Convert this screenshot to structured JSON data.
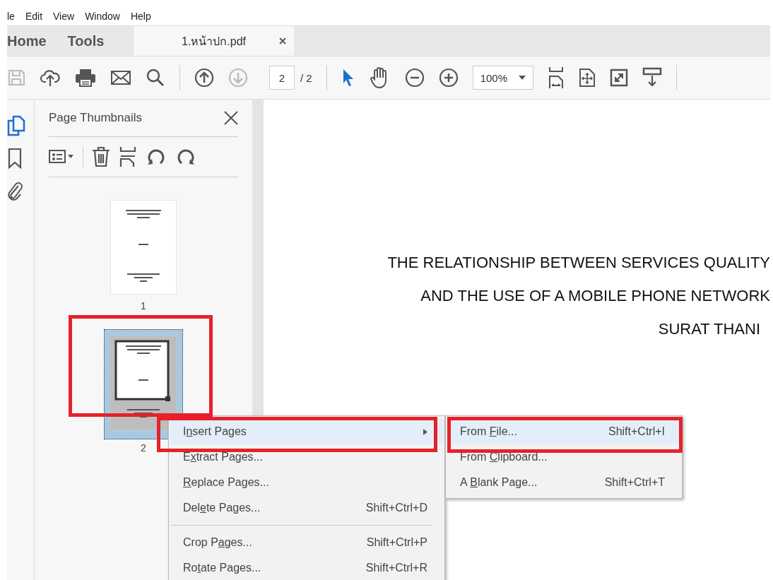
{
  "menu_bar": [
    "le",
    "Edit",
    "View",
    "Window",
    "Help"
  ],
  "tabs": [
    {
      "label": "Home",
      "selected": false,
      "kind": "nav"
    },
    {
      "label": "Tools",
      "selected": false,
      "kind": "nav"
    },
    {
      "label": "1.หน้าปก.pdf",
      "selected": true,
      "kind": "document"
    }
  ],
  "toolbar": {
    "page_number": "2",
    "page_total": "/ 2",
    "zoom": "100%"
  },
  "side_rail": [
    {
      "kind": "pages",
      "selected": true
    },
    {
      "kind": "bookmark",
      "selected": false
    },
    {
      "kind": "attachment",
      "selected": false
    }
  ],
  "panel": {
    "title": "Page Thumbnails",
    "thumbnails": [
      {
        "label": "1",
        "selected": false
      },
      {
        "label": "2",
        "selected": true
      }
    ]
  },
  "document": {
    "lines": [
      "THE RELATIONSHIP BETWEEN SERVICES QUALITY",
      "AND THE USE OF A MOBILE PHONE NETWORK",
      "SURAT THANI"
    ]
  },
  "context_menu": {
    "sections": [
      [
        {
          "before": "I",
          "key": "n",
          "after": "sert Pages",
          "submenu": true,
          "selected": true
        },
        {
          "before": "E",
          "key": "x",
          "after": "tract Pages...",
          "submenu": false,
          "selected": false
        },
        {
          "key": "R",
          "after": "eplace Pages...",
          "submenu": false,
          "selected": false
        },
        {
          "before": "Del",
          "key": "e",
          "after": "te Pages...",
          "shortcut": "Shift+Ctrl+D",
          "submenu": false,
          "selected": false
        }
      ],
      [
        {
          "before": "Crop P",
          "key": "a",
          "after": "ges...",
          "shortcut": "Shift+Ctrl+P",
          "submenu": false,
          "selected": false
        },
        {
          "before": "Ro",
          "key": "t",
          "after": "ate Pages...",
          "shortcut": "Shift+Ctrl+R",
          "submenu": false,
          "selected": false
        }
      ]
    ]
  },
  "submenu": {
    "items": [
      {
        "before": "From ",
        "key": "F",
        "after": "ile...",
        "shortcut": "Shift+Ctrl+I",
        "selected": true
      },
      {
        "before": "From ",
        "key": "C",
        "after": "lipboard...",
        "selected": false
      },
      {
        "before": "A ",
        "key": "B",
        "after": "lank Page...",
        "shortcut": "Shift+Ctrl+T",
        "selected": false
      }
    ]
  }
}
